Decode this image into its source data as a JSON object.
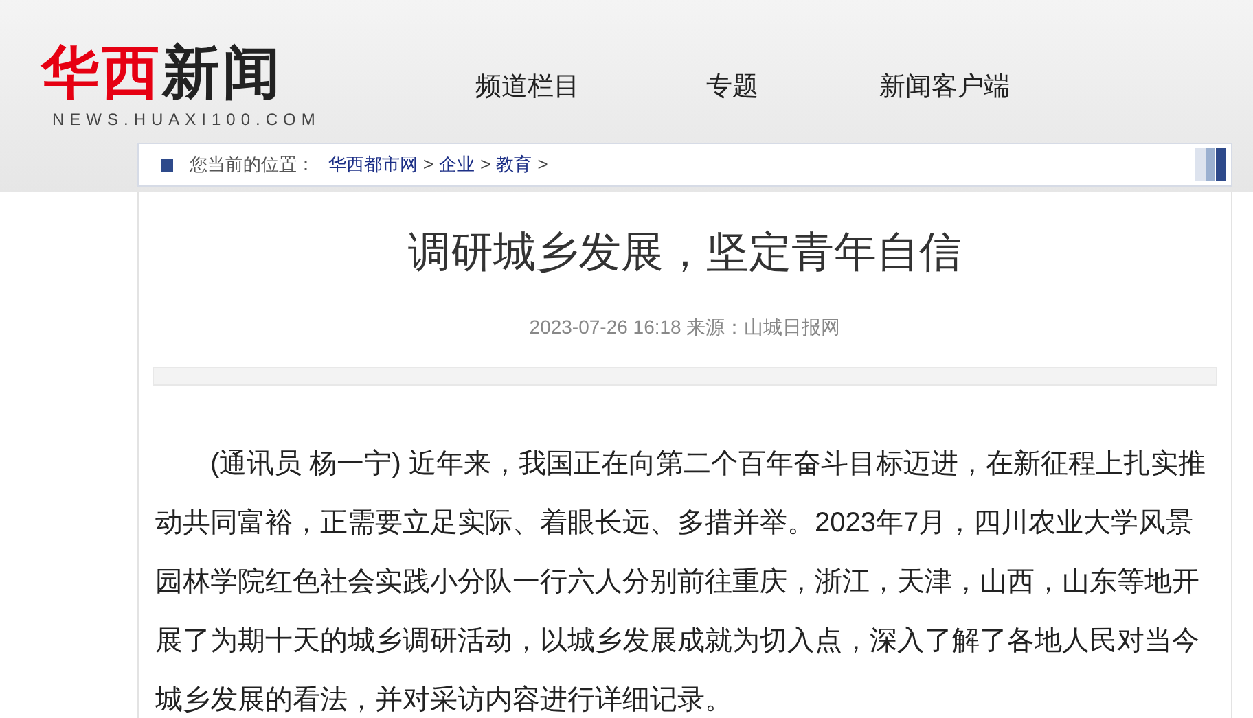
{
  "logo": {
    "red": "华西",
    "black": "新闻",
    "domain": "NEWS.HUAXI100.COM"
  },
  "nav": [
    {
      "label": "频道栏目"
    },
    {
      "label": "专题"
    },
    {
      "label": "新闻客户端"
    }
  ],
  "breadcrumb": {
    "label": "您当前的位置：",
    "parts": [
      {
        "kind": "link",
        "text": "华西都市网"
      },
      {
        "kind": "sep",
        "text": ">"
      },
      {
        "kind": "link",
        "text": "企业"
      },
      {
        "kind": "sep",
        "text": ">"
      },
      {
        "kind": "link",
        "text": "教育"
      },
      {
        "kind": "sep",
        "text": ">"
      }
    ]
  },
  "article": {
    "title": "调研城乡发展，坚定青年自信",
    "meta": "2023-07-26 16:18 来源：山城日报网",
    "paragraphs": [
      "(通讯员 杨一宁) 近年来，我国正在向第二个百年奋斗目标迈进，在新征程上扎实推动共同富裕，正需要立足实际、着眼长远、多措并举。2023年7月，四川农业大学风景园林学院红色社会实践小分队一行六人分别前往重庆，浙江，天津，山西，山东等地开展了为期十天的城乡调研活动，以城乡发展成就为切入点，深入了解了各地人民对当今城乡发展的看法，并对采访内容进行详细记录。"
    ]
  }
}
